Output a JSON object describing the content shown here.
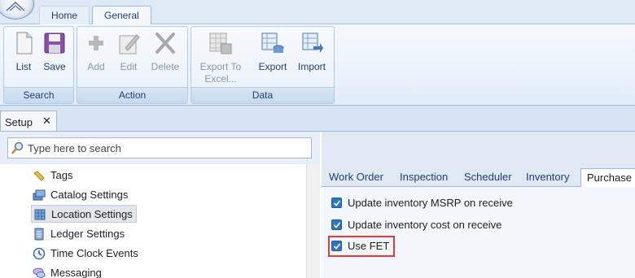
{
  "ribbon_tabs": {
    "home": "Home",
    "general": "General"
  },
  "groups": {
    "search": {
      "label": "Search",
      "list": "List",
      "save": "Save"
    },
    "action": {
      "label": "Action",
      "add": "Add",
      "edit": "Edit",
      "delete": "Delete"
    },
    "data": {
      "label": "Data",
      "export_excel": "Export To Excel...",
      "export": "Export",
      "import": "Import"
    }
  },
  "doc_tab": {
    "label": "Setup",
    "close": "✕"
  },
  "search": {
    "placeholder": "Type here to search"
  },
  "tree": {
    "items": [
      {
        "label": "Tags",
        "icon": "tag-icon"
      },
      {
        "label": "Catalog Settings",
        "icon": "catalog-icon"
      },
      {
        "label": "Location Settings",
        "icon": "location-icon"
      },
      {
        "label": "Ledger Settings",
        "icon": "ledger-icon"
      },
      {
        "label": "Time Clock Events",
        "icon": "clock-icon"
      },
      {
        "label": "Messaging",
        "icon": "messaging-icon"
      }
    ],
    "selected": "Location Settings"
  },
  "settings_tabs": [
    "Work Order",
    "Inspection",
    "Scheduler",
    "Inventory",
    "Purchase"
  ],
  "active_settings_tab": "Purchase",
  "options": [
    {
      "label": "Update inventory MSRP on receive",
      "checked": true
    },
    {
      "label": "Update inventory cost on receive",
      "checked": true
    },
    {
      "label": "Use FET",
      "checked": true
    }
  ],
  "colors": {
    "accent": "#2f74c6",
    "highlight": "#e23b3b",
    "ribbon_text": "#1e3f6e"
  }
}
